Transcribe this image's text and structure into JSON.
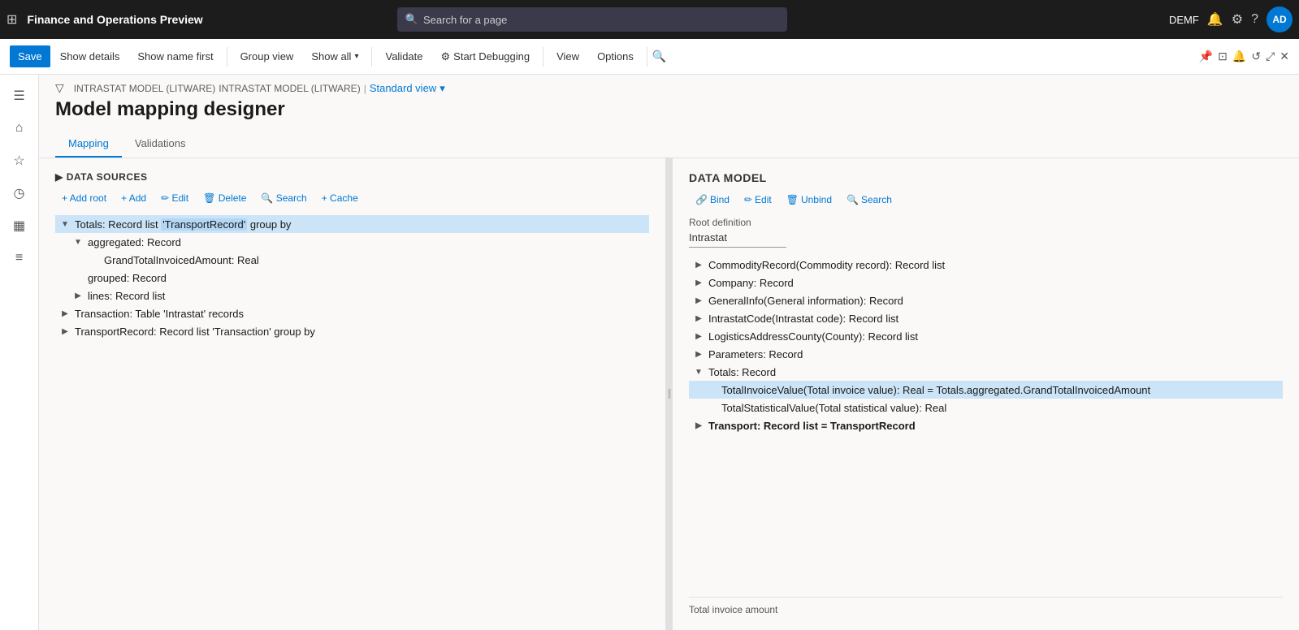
{
  "app": {
    "title": "Finance and Operations Preview",
    "search_placeholder": "Search for a page",
    "user": "DEMF",
    "avatar": "AD"
  },
  "action_bar": {
    "save": "Save",
    "show_details": "Show details",
    "show_name_first": "Show name first",
    "group_view": "Group view",
    "show_all": "Show all",
    "validate": "Validate",
    "start_debugging": "Start Debugging",
    "view": "View",
    "options": "Options"
  },
  "breadcrumb": {
    "part1": "INTRASTAT MODEL (LITWARE)",
    "part2": "INTRASTAT MODEL (LITWARE)",
    "separator": "|",
    "view": "Standard view"
  },
  "page": {
    "title": "Model mapping designer"
  },
  "tabs": [
    {
      "label": "Mapping",
      "active": true
    },
    {
      "label": "Validations",
      "active": false
    }
  ],
  "data_sources": {
    "header": "DATA SOURCES",
    "toolbar": {
      "add_root": "+ Add root",
      "add": "+ Add",
      "edit": "✏ Edit",
      "delete": "🗑 Delete",
      "search": "🔍 Search",
      "cache": "+ Cache"
    },
    "tree": [
      {
        "id": "totals",
        "label": "Totals: Record list ",
        "highlight": "TransportRecord",
        "label_suffix": "' group by",
        "indent": 0,
        "expanded": true,
        "selected": true,
        "toggle": "▼"
      },
      {
        "id": "aggregated",
        "label": "aggregated: Record",
        "indent": 1,
        "expanded": true,
        "toggle": "▼"
      },
      {
        "id": "grand_total",
        "label": "GrandTotalInvoicedAmount: Real",
        "indent": 2,
        "expanded": false,
        "toggle": ""
      },
      {
        "id": "grouped",
        "label": "grouped: Record",
        "indent": 1,
        "expanded": false,
        "toggle": ""
      },
      {
        "id": "lines",
        "label": "lines: Record list",
        "indent": 1,
        "expanded": false,
        "toggle": "▶"
      },
      {
        "id": "transaction",
        "label": "Transaction: Table 'Intrastat' records",
        "indent": 0,
        "expanded": false,
        "toggle": "▶"
      },
      {
        "id": "transport_record",
        "label": "TransportRecord: Record list 'Transaction' group by",
        "indent": 0,
        "expanded": false,
        "toggle": "▶"
      }
    ]
  },
  "data_model": {
    "header": "DATA MODEL",
    "toolbar": {
      "bind": "Bind",
      "edit": "Edit",
      "unbind": "Unbind",
      "search": "Search"
    },
    "root_definition_label": "Root definition",
    "root_definition_value": "Intrastat",
    "tree": [
      {
        "id": "commodity_record",
        "label": "CommodityRecord(Commodity record): Record list",
        "indent": 0,
        "toggle": "▶"
      },
      {
        "id": "company",
        "label": "Company: Record",
        "indent": 0,
        "toggle": "▶"
      },
      {
        "id": "general_info",
        "label": "GeneralInfo(General information): Record",
        "indent": 0,
        "toggle": "▶"
      },
      {
        "id": "intrastat_code",
        "label": "IntrastatCode(Intrastat code): Record list",
        "indent": 0,
        "toggle": "▶"
      },
      {
        "id": "logistics_address",
        "label": "LogisticsAddressCounty(County): Record list",
        "indent": 0,
        "toggle": "▶"
      },
      {
        "id": "parameters",
        "label": "Parameters: Record",
        "indent": 0,
        "toggle": "▶"
      },
      {
        "id": "totals_record",
        "label": "Totals: Record",
        "indent": 0,
        "expanded": true,
        "toggle": "▼"
      },
      {
        "id": "total_invoice_value",
        "label": "TotalInvoiceValue(Total invoice value): Real = Totals.aggregated.GrandTotalInvoicedAmount",
        "indent": 1,
        "selected": true,
        "toggle": ""
      },
      {
        "id": "total_statistical_value",
        "label": "TotalStatisticalValue(Total statistical value): Real",
        "indent": 1,
        "toggle": ""
      },
      {
        "id": "transport",
        "label": "Transport: Record list = TransportRecord",
        "indent": 0,
        "toggle": "▶",
        "bold": true
      }
    ],
    "bottom_label": "Total invoice amount"
  }
}
